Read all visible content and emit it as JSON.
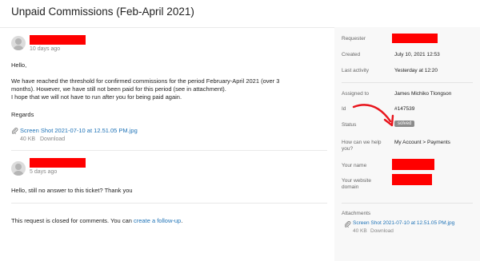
{
  "page": {
    "title": "Unpaid Commissions (Feb-April 2021)"
  },
  "comments": [
    {
      "time": "10 days ago",
      "lines": [
        "Hello,",
        "We have reached the threshold for confirmed commissions for the period February-April 2021 (over 3",
        "months). However, we have still not been paid for this period (see in attachment).",
        "I hope that we will not have to run after you for being paid again.",
        "Regards"
      ],
      "attachment": {
        "name": "Screen Shot 2021-07-10 at 12.51.05 PM.jpg",
        "size": "40 KB",
        "download": "Download"
      }
    },
    {
      "time": "5 days ago",
      "lines": [
        "Hello, still no answer to this ticket? Thank you"
      ]
    }
  ],
  "closed_notice": {
    "text": "This request is closed for comments. You can",
    "link": "create a follow-up",
    "suffix": "."
  },
  "sidebar": {
    "requester_label": "Requester",
    "created_label": "Created",
    "created_value": "July 10, 2021 12:53",
    "last_activity_label": "Last activity",
    "last_activity_value": "Yesterday at 12:20",
    "assigned_label": "Assigned to",
    "assigned_value": "James Michiko Tlongson",
    "id_label": "Id",
    "id_value": "#147539",
    "status_label": "Status",
    "status_value": "solved",
    "help_label_1": "How can we help",
    "help_label_2": "you?",
    "help_value": "My Account > Payments",
    "your_name_label": "Your name",
    "website_label_1": "Your website",
    "website_label_2": "domain",
    "attachments_label": "Attachments",
    "attachment": {
      "name": "Screen Shot 2021-07-10 at 12.51.05 PM.jpg",
      "size": "40 KB",
      "download": "Download"
    }
  },
  "colors": {
    "link": "#1f73b7",
    "redaction": "#ff0000",
    "status_badge": "#8c8c8c",
    "sidebar_bg": "#f8f8f8",
    "annotation_arrow": "#e8141c"
  },
  "icons": [
    "avatar-icon",
    "paperclip-icon",
    "annotation-arrow-icon"
  ]
}
